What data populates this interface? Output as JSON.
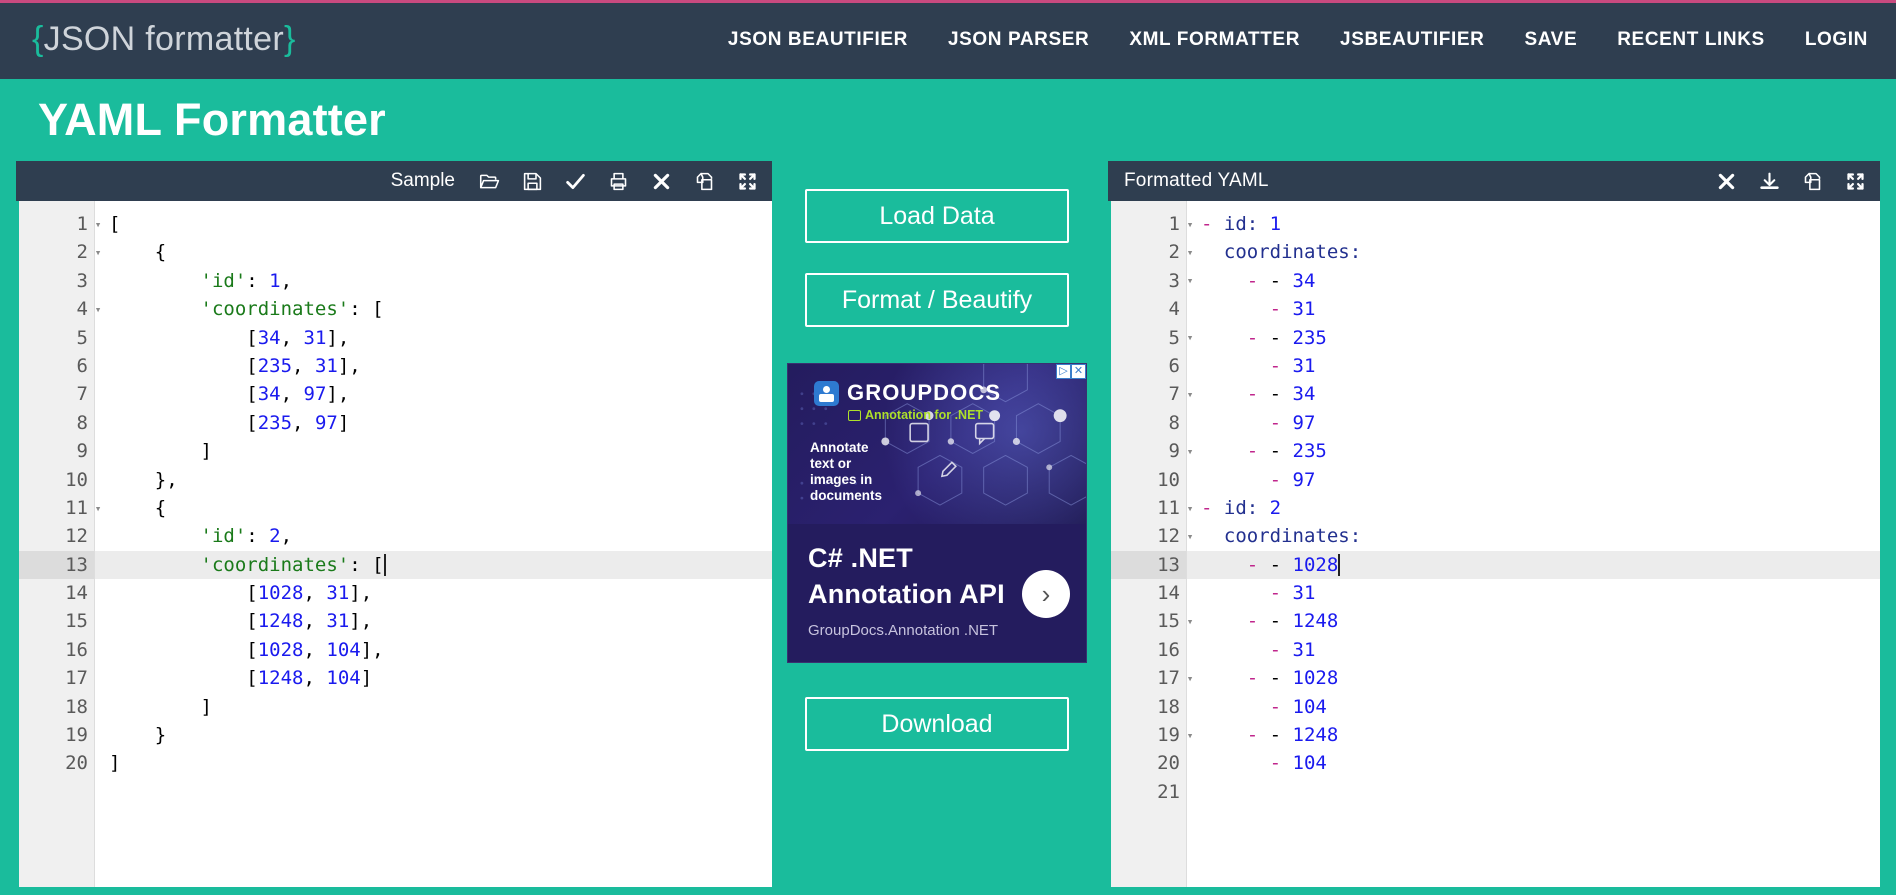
{
  "brand": {
    "open_brace": "{",
    "name": "JSON formatter",
    "close_brace": "}"
  },
  "nav": {
    "items": [
      {
        "label": "JSON BEAUTIFIER"
      },
      {
        "label": "JSON PARSER"
      },
      {
        "label": "XML FORMATTER"
      },
      {
        "label": "JSBEAUTIFIER"
      },
      {
        "label": "SAVE"
      },
      {
        "label": "RECENT LINKS"
      },
      {
        "label": "LOGIN"
      }
    ]
  },
  "hero": {
    "title": "YAML Formatter"
  },
  "colors": {
    "navbar": "#2f3e50",
    "accent_teal": "#1abc9c",
    "top_rule_pink": "#c94a7f",
    "string_green": "#1a7a1a",
    "number_blue": "#1a1aee",
    "yaml_key_navy": "#22308f",
    "yaml_dash_magenta": "#c0268c"
  },
  "input_panel": {
    "title": "",
    "sample_label": "Sample",
    "tools": [
      {
        "name": "open-folder-icon",
        "title": "Open"
      },
      {
        "name": "save-disk-icon",
        "title": "Save"
      },
      {
        "name": "validate-check-icon",
        "title": "Validate"
      },
      {
        "name": "print-icon",
        "title": "Print"
      },
      {
        "name": "clear-close-icon",
        "title": "Clear"
      },
      {
        "name": "copy-icon",
        "title": "Copy"
      },
      {
        "name": "fullscreen-icon",
        "title": "Fullscreen"
      }
    ],
    "active_line": 13,
    "lines": [
      {
        "n": 1,
        "fold": true,
        "tokens": [
          {
            "t": "pun",
            "v": "["
          }
        ]
      },
      {
        "n": 2,
        "fold": true,
        "tokens": [
          {
            "t": "pun",
            "v": "    {"
          }
        ]
      },
      {
        "n": 3,
        "fold": false,
        "tokens": [
          {
            "t": "str",
            "v": "        'id'"
          },
          {
            "t": "pun",
            "v": ": "
          },
          {
            "t": "num",
            "v": "1"
          },
          {
            "t": "pun",
            "v": ","
          }
        ]
      },
      {
        "n": 4,
        "fold": true,
        "tokens": [
          {
            "t": "str",
            "v": "        'coordinates'"
          },
          {
            "t": "pun",
            "v": ": ["
          }
        ]
      },
      {
        "n": 5,
        "fold": false,
        "tokens": [
          {
            "t": "pun",
            "v": "            ["
          },
          {
            "t": "num",
            "v": "34"
          },
          {
            "t": "pun",
            "v": ", "
          },
          {
            "t": "num",
            "v": "31"
          },
          {
            "t": "pun",
            "v": "],"
          }
        ]
      },
      {
        "n": 6,
        "fold": false,
        "tokens": [
          {
            "t": "pun",
            "v": "            ["
          },
          {
            "t": "num",
            "v": "235"
          },
          {
            "t": "pun",
            "v": ", "
          },
          {
            "t": "num",
            "v": "31"
          },
          {
            "t": "pun",
            "v": "],"
          }
        ]
      },
      {
        "n": 7,
        "fold": false,
        "tokens": [
          {
            "t": "pun",
            "v": "            ["
          },
          {
            "t": "num",
            "v": "34"
          },
          {
            "t": "pun",
            "v": ", "
          },
          {
            "t": "num",
            "v": "97"
          },
          {
            "t": "pun",
            "v": "],"
          }
        ]
      },
      {
        "n": 8,
        "fold": false,
        "tokens": [
          {
            "t": "pun",
            "v": "            ["
          },
          {
            "t": "num",
            "v": "235"
          },
          {
            "t": "pun",
            "v": ", "
          },
          {
            "t": "num",
            "v": "97"
          },
          {
            "t": "pun",
            "v": "]"
          }
        ]
      },
      {
        "n": 9,
        "fold": false,
        "tokens": [
          {
            "t": "pun",
            "v": "        ]"
          }
        ]
      },
      {
        "n": 10,
        "fold": false,
        "tokens": [
          {
            "t": "pun",
            "v": "    },"
          }
        ]
      },
      {
        "n": 11,
        "fold": true,
        "tokens": [
          {
            "t": "pun",
            "v": "    {"
          }
        ]
      },
      {
        "n": 12,
        "fold": false,
        "tokens": [
          {
            "t": "str",
            "v": "        'id'"
          },
          {
            "t": "pun",
            "v": ": "
          },
          {
            "t": "num",
            "v": "2"
          },
          {
            "t": "pun",
            "v": ","
          }
        ]
      },
      {
        "n": 13,
        "fold": true,
        "caret": true,
        "tokens": [
          {
            "t": "str",
            "v": "        'coordinates'"
          },
          {
            "t": "pun",
            "v": ": ["
          }
        ]
      },
      {
        "n": 14,
        "fold": false,
        "tokens": [
          {
            "t": "pun",
            "v": "            ["
          },
          {
            "t": "num",
            "v": "1028"
          },
          {
            "t": "pun",
            "v": ", "
          },
          {
            "t": "num",
            "v": "31"
          },
          {
            "t": "pun",
            "v": "],"
          }
        ]
      },
      {
        "n": 15,
        "fold": false,
        "tokens": [
          {
            "t": "pun",
            "v": "            ["
          },
          {
            "t": "num",
            "v": "1248"
          },
          {
            "t": "pun",
            "v": ", "
          },
          {
            "t": "num",
            "v": "31"
          },
          {
            "t": "pun",
            "v": "],"
          }
        ]
      },
      {
        "n": 16,
        "fold": false,
        "tokens": [
          {
            "t": "pun",
            "v": "            ["
          },
          {
            "t": "num",
            "v": "1028"
          },
          {
            "t": "pun",
            "v": ", "
          },
          {
            "t": "num",
            "v": "104"
          },
          {
            "t": "pun",
            "v": "],"
          }
        ]
      },
      {
        "n": 17,
        "fold": false,
        "tokens": [
          {
            "t": "pun",
            "v": "            ["
          },
          {
            "t": "num",
            "v": "1248"
          },
          {
            "t": "pun",
            "v": ", "
          },
          {
            "t": "num",
            "v": "104"
          },
          {
            "t": "pun",
            "v": "]"
          }
        ]
      },
      {
        "n": 18,
        "fold": false,
        "tokens": [
          {
            "t": "pun",
            "v": "        ]"
          }
        ]
      },
      {
        "n": 19,
        "fold": false,
        "tokens": [
          {
            "t": "pun",
            "v": "    }"
          }
        ]
      },
      {
        "n": 20,
        "fold": false,
        "tokens": [
          {
            "t": "pun",
            "v": "]"
          }
        ]
      }
    ]
  },
  "center": {
    "load_button": "Load Data",
    "format_button": "Format / Beautify",
    "download_button": "Download"
  },
  "ad": {
    "badge_play": "▷",
    "badge_close": "✕",
    "brand": "GROUPDOCS",
    "product": "Annotation for .NET",
    "tagline": "Annotate\ntext or\nimages in\ndocuments",
    "headline_line1": "C# .NET",
    "headline_line2": "Annotation API",
    "footer": "GroupDocs.Annotation .NET",
    "arrow": "›"
  },
  "output_panel": {
    "title": "Formatted YAML",
    "tools": [
      {
        "name": "clear-close-icon",
        "title": "Clear"
      },
      {
        "name": "download-icon",
        "title": "Download"
      },
      {
        "name": "copy-icon",
        "title": "Copy"
      },
      {
        "name": "fullscreen-icon",
        "title": "Fullscreen"
      }
    ],
    "active_line": 13,
    "lines": [
      {
        "n": 1,
        "fold": true,
        "tokens": [
          {
            "t": "dash",
            "v": "- "
          },
          {
            "t": "key",
            "v": "id"
          },
          {
            "t": "key",
            "v": ": "
          },
          {
            "t": "num",
            "v": "1"
          }
        ]
      },
      {
        "n": 2,
        "fold": true,
        "tokens": [
          {
            "t": "key",
            "v": "  coordinates:"
          }
        ]
      },
      {
        "n": 3,
        "fold": true,
        "tokens": [
          {
            "t": "dash",
            "v": "    - "
          },
          {
            "t": "pun",
            "v": "- "
          },
          {
            "t": "num",
            "v": "34"
          }
        ]
      },
      {
        "n": 4,
        "fold": false,
        "tokens": [
          {
            "t": "pun",
            "v": "      "
          },
          {
            "t": "dash",
            "v": "- "
          },
          {
            "t": "num",
            "v": "31"
          }
        ]
      },
      {
        "n": 5,
        "fold": true,
        "tokens": [
          {
            "t": "dash",
            "v": "    - "
          },
          {
            "t": "pun",
            "v": "- "
          },
          {
            "t": "num",
            "v": "235"
          }
        ]
      },
      {
        "n": 6,
        "fold": false,
        "tokens": [
          {
            "t": "pun",
            "v": "      "
          },
          {
            "t": "dash",
            "v": "- "
          },
          {
            "t": "num",
            "v": "31"
          }
        ]
      },
      {
        "n": 7,
        "fold": true,
        "tokens": [
          {
            "t": "dash",
            "v": "    - "
          },
          {
            "t": "pun",
            "v": "- "
          },
          {
            "t": "num",
            "v": "34"
          }
        ]
      },
      {
        "n": 8,
        "fold": false,
        "tokens": [
          {
            "t": "pun",
            "v": "      "
          },
          {
            "t": "dash",
            "v": "- "
          },
          {
            "t": "num",
            "v": "97"
          }
        ]
      },
      {
        "n": 9,
        "fold": true,
        "tokens": [
          {
            "t": "dash",
            "v": "    - "
          },
          {
            "t": "pun",
            "v": "- "
          },
          {
            "t": "num",
            "v": "235"
          }
        ]
      },
      {
        "n": 10,
        "fold": false,
        "tokens": [
          {
            "t": "pun",
            "v": "      "
          },
          {
            "t": "dash",
            "v": "- "
          },
          {
            "t": "num",
            "v": "97"
          }
        ]
      },
      {
        "n": 11,
        "fold": true,
        "tokens": [
          {
            "t": "dash",
            "v": "- "
          },
          {
            "t": "key",
            "v": "id"
          },
          {
            "t": "key",
            "v": ": "
          },
          {
            "t": "num",
            "v": "2"
          }
        ]
      },
      {
        "n": 12,
        "fold": true,
        "tokens": [
          {
            "t": "key",
            "v": "  coordinates:"
          }
        ]
      },
      {
        "n": 13,
        "fold": true,
        "caret": true,
        "tokens": [
          {
            "t": "dash",
            "v": "    - "
          },
          {
            "t": "pun",
            "v": "- "
          },
          {
            "t": "num",
            "v": "1028"
          }
        ]
      },
      {
        "n": 14,
        "fold": false,
        "tokens": [
          {
            "t": "pun",
            "v": "      "
          },
          {
            "t": "dash",
            "v": "- "
          },
          {
            "t": "num",
            "v": "31"
          }
        ]
      },
      {
        "n": 15,
        "fold": true,
        "tokens": [
          {
            "t": "dash",
            "v": "    - "
          },
          {
            "t": "pun",
            "v": "- "
          },
          {
            "t": "num",
            "v": "1248"
          }
        ]
      },
      {
        "n": 16,
        "fold": false,
        "tokens": [
          {
            "t": "pun",
            "v": "      "
          },
          {
            "t": "dash",
            "v": "- "
          },
          {
            "t": "num",
            "v": "31"
          }
        ]
      },
      {
        "n": 17,
        "fold": true,
        "tokens": [
          {
            "t": "dash",
            "v": "    - "
          },
          {
            "t": "pun",
            "v": "- "
          },
          {
            "t": "num",
            "v": "1028"
          }
        ]
      },
      {
        "n": 18,
        "fold": false,
        "tokens": [
          {
            "t": "pun",
            "v": "      "
          },
          {
            "t": "dash",
            "v": "- "
          },
          {
            "t": "num",
            "v": "104"
          }
        ]
      },
      {
        "n": 19,
        "fold": true,
        "tokens": [
          {
            "t": "dash",
            "v": "    - "
          },
          {
            "t": "pun",
            "v": "- "
          },
          {
            "t": "num",
            "v": "1248"
          }
        ]
      },
      {
        "n": 20,
        "fold": false,
        "tokens": [
          {
            "t": "pun",
            "v": "      "
          },
          {
            "t": "dash",
            "v": "- "
          },
          {
            "t": "num",
            "v": "104"
          }
        ]
      },
      {
        "n": 21,
        "fold": false,
        "tokens": [
          {
            "t": "pun",
            "v": ""
          }
        ]
      }
    ]
  }
}
